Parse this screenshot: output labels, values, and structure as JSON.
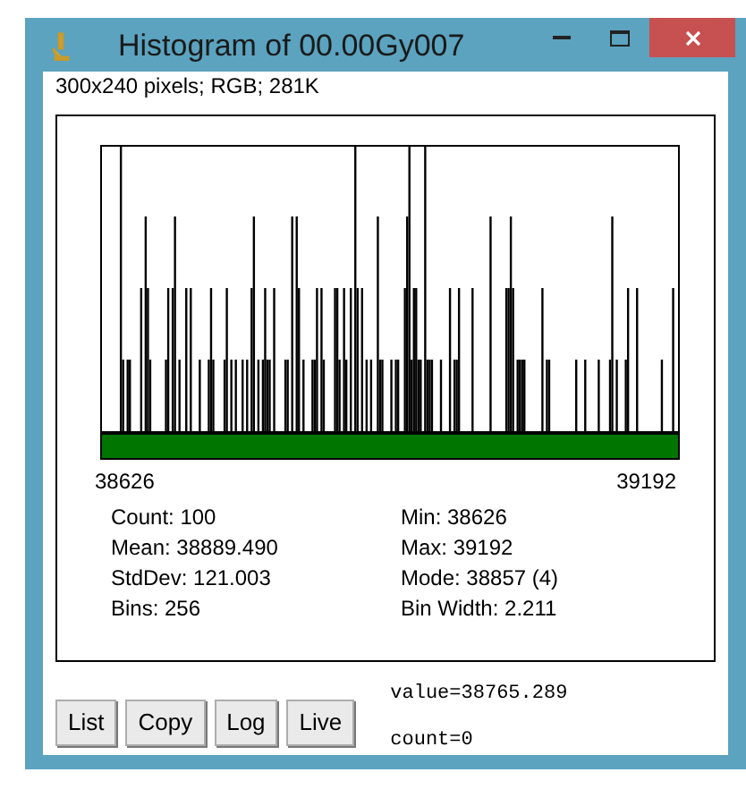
{
  "window": {
    "title": "Histogram of 00.00Gy007"
  },
  "subtitle": "300x240 pixels; RGB; 281K",
  "histogram": {
    "x_min_label": "38626",
    "x_max_label": "39192"
  },
  "stats": [
    [
      "Count: 100",
      "Min: 38626"
    ],
    [
      "Mean: 38889.490",
      "Max: 39192"
    ],
    [
      "StdDev: 121.003",
      "Mode: 38857 (4)"
    ],
    [
      "Bins: 256",
      "Bin Width: 2.211"
    ]
  ],
  "buttons": [
    "List",
    "Copy",
    "Log",
    "Live"
  ],
  "readout": {
    "value": "value=38765.289",
    "count": "count=0"
  }
}
